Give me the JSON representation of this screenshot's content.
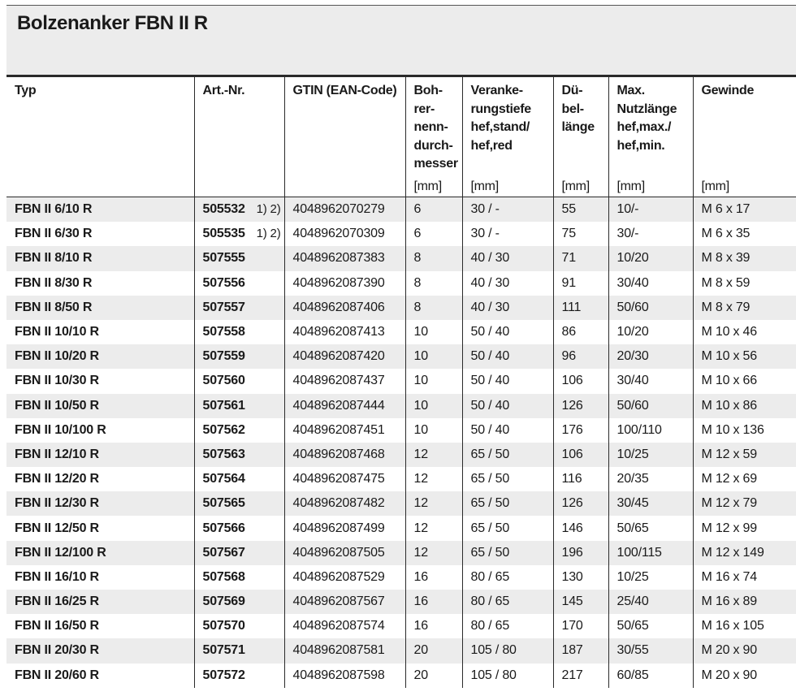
{
  "title": "Bolzenanker FBN II R",
  "headers": [
    {
      "label": "Typ",
      "unit": ""
    },
    {
      "label": "Art.-Nr.",
      "unit": ""
    },
    {
      "label": "GTIN (EAN-Code)",
      "unit": ""
    },
    {
      "label": "Boh-\nrer-\nnenn-\ndurch-\nmesser",
      "unit": "[mm]"
    },
    {
      "label": "Veranke-\nrungstiefe\nhef,stand/\nhef,red",
      "unit": "[mm]"
    },
    {
      "label": "Dü-\nbel-\nlänge",
      "unit": "[mm]"
    },
    {
      "label": "Max.\nNutzlänge\nhef,max./\nhef,min.",
      "unit": "[mm]"
    },
    {
      "label": "Gewinde",
      "unit": "[mm]"
    }
  ],
  "rows": [
    {
      "typ": "FBN II 6/10 R",
      "art": "505532",
      "fn": "1) 2)",
      "gtin": "4048962070279",
      "bohrer": "6",
      "veranker": "30 / -",
      "laenge": "55",
      "nutz": "10/-",
      "gewinde": "M 6 x 17"
    },
    {
      "typ": "FBN II 6/30 R",
      "art": "505535",
      "fn": "1) 2)",
      "gtin": "4048962070309",
      "bohrer": "6",
      "veranker": "30 / -",
      "laenge": "75",
      "nutz": "30/-",
      "gewinde": "M 6 x 35"
    },
    {
      "typ": "FBN II 8/10 R",
      "art": "507555",
      "fn": "",
      "gtin": "4048962087383",
      "bohrer": "8",
      "veranker": "40 / 30",
      "laenge": "71",
      "nutz": "10/20",
      "gewinde": "M 8 x 39"
    },
    {
      "typ": "FBN II 8/30 R",
      "art": "507556",
      "fn": "",
      "gtin": "4048962087390",
      "bohrer": "8",
      "veranker": "40 / 30",
      "laenge": "91",
      "nutz": "30/40",
      "gewinde": "M 8 x 59"
    },
    {
      "typ": "FBN II 8/50 R",
      "art": "507557",
      "fn": "",
      "gtin": "4048962087406",
      "bohrer": "8",
      "veranker": "40 / 30",
      "laenge": "111",
      "nutz": "50/60",
      "gewinde": "M 8 x 79"
    },
    {
      "typ": "FBN II 10/10 R",
      "art": "507558",
      "fn": "",
      "gtin": "4048962087413",
      "bohrer": "10",
      "veranker": "50 / 40",
      "laenge": "86",
      "nutz": "10/20",
      "gewinde": "M 10 x 46"
    },
    {
      "typ": "FBN II 10/20 R",
      "art": "507559",
      "fn": "",
      "gtin": "4048962087420",
      "bohrer": "10",
      "veranker": "50 / 40",
      "laenge": "96",
      "nutz": "20/30",
      "gewinde": "M 10 x 56"
    },
    {
      "typ": "FBN II 10/30 R",
      "art": "507560",
      "fn": "",
      "gtin": "4048962087437",
      "bohrer": "10",
      "veranker": "50 / 40",
      "laenge": "106",
      "nutz": "30/40",
      "gewinde": "M 10 x 66"
    },
    {
      "typ": "FBN II 10/50 R",
      "art": "507561",
      "fn": "",
      "gtin": "4048962087444",
      "bohrer": "10",
      "veranker": "50 / 40",
      "laenge": "126",
      "nutz": "50/60",
      "gewinde": "M 10 x 86"
    },
    {
      "typ": "FBN II 10/100 R",
      "art": "507562",
      "fn": "",
      "gtin": "4048962087451",
      "bohrer": "10",
      "veranker": "50 / 40",
      "laenge": "176",
      "nutz": "100/110",
      "gewinde": "M 10 x 136"
    },
    {
      "typ": "FBN II 12/10 R",
      "art": "507563",
      "fn": "",
      "gtin": "4048962087468",
      "bohrer": "12",
      "veranker": "65 / 50",
      "laenge": "106",
      "nutz": "10/25",
      "gewinde": "M 12 x 59"
    },
    {
      "typ": "FBN II 12/20 R",
      "art": "507564",
      "fn": "",
      "gtin": "4048962087475",
      "bohrer": "12",
      "veranker": "65 / 50",
      "laenge": "116",
      "nutz": "20/35",
      "gewinde": "M 12 x 69"
    },
    {
      "typ": "FBN II 12/30 R",
      "art": "507565",
      "fn": "",
      "gtin": "4048962087482",
      "bohrer": "12",
      "veranker": "65 / 50",
      "laenge": "126",
      "nutz": "30/45",
      "gewinde": "M 12 x 79"
    },
    {
      "typ": "FBN II 12/50 R",
      "art": "507566",
      "fn": "",
      "gtin": "4048962087499",
      "bohrer": "12",
      "veranker": "65 / 50",
      "laenge": "146",
      "nutz": "50/65",
      "gewinde": "M 12 x 99"
    },
    {
      "typ": "FBN II 12/100 R",
      "art": "507567",
      "fn": "",
      "gtin": "4048962087505",
      "bohrer": "12",
      "veranker": "65 / 50",
      "laenge": "196",
      "nutz": "100/115",
      "gewinde": "M 12 x 149"
    },
    {
      "typ": "FBN II 16/10 R",
      "art": "507568",
      "fn": "",
      "gtin": "4048962087529",
      "bohrer": "16",
      "veranker": "80 / 65",
      "laenge": "130",
      "nutz": "10/25",
      "gewinde": "M 16 x 74"
    },
    {
      "typ": "FBN II 16/25 R",
      "art": "507569",
      "fn": "",
      "gtin": "4048962087567",
      "bohrer": "16",
      "veranker": "80 / 65",
      "laenge": "145",
      "nutz": "25/40",
      "gewinde": "M 16 x 89"
    },
    {
      "typ": "FBN II 16/50 R",
      "art": "507570",
      "fn": "",
      "gtin": "4048962087574",
      "bohrer": "16",
      "veranker": "80 / 65",
      "laenge": "170",
      "nutz": "50/65",
      "gewinde": "M 16 x 105"
    },
    {
      "typ": "FBN II 20/30 R",
      "art": "507571",
      "fn": "",
      "gtin": "4048962087581",
      "bohrer": "20",
      "veranker": "105 / 80",
      "laenge": "187",
      "nutz": "30/55",
      "gewinde": "M 20 x 90"
    },
    {
      "typ": "FBN II 20/60 R",
      "art": "507572",
      "fn": "",
      "gtin": "4048962087598",
      "bohrer": "20",
      "veranker": "105 / 80",
      "laenge": "217",
      "nutz": "60/85",
      "gewinde": "M 20 x 90"
    }
  ]
}
